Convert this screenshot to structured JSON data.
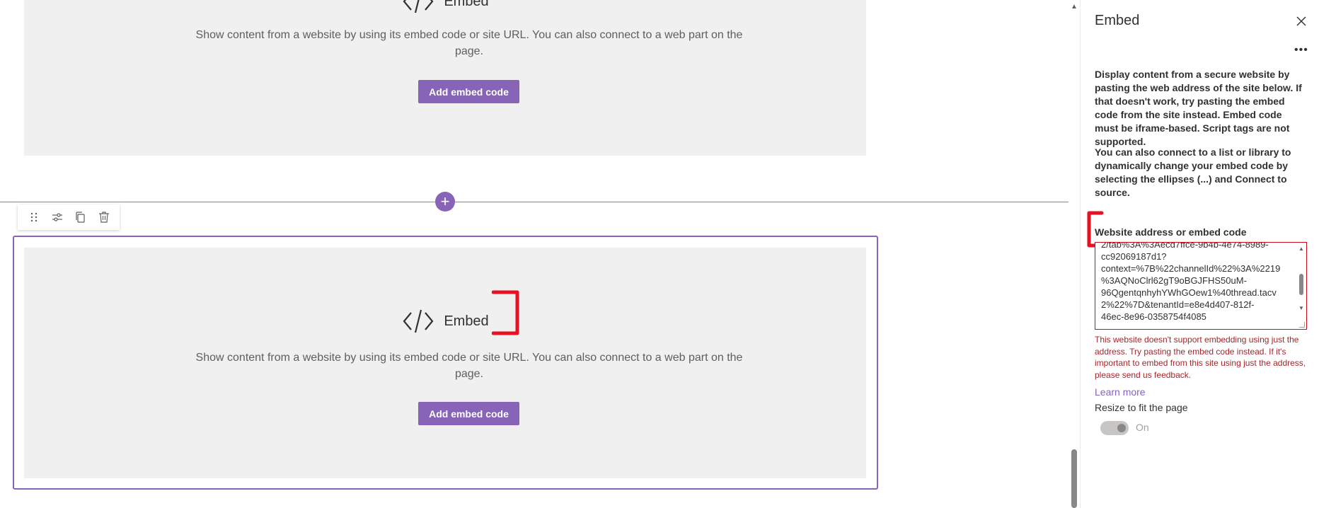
{
  "canvas": {
    "top_card": {
      "title": "Embed",
      "description": "Show content from a website by using its embed code or site URL. You can also connect to a web part on the page.",
      "button_label": "Add embed code"
    },
    "bottom_card": {
      "title": "Embed",
      "description": "Show content from a website by using its embed code or site URL. You can also connect to a web part on the page.",
      "button_label": "Add embed code"
    },
    "add_section_symbol": "+",
    "toolbar_icons": [
      "drag-handle-icon",
      "edit-properties-icon",
      "duplicate-icon",
      "delete-icon"
    ]
  },
  "pane": {
    "title": "Embed",
    "more_symbol": "•••",
    "paragraph_1": "Display content from a secure website by pasting the web address of the site below. If that doesn't work, try pasting the embed code from the site instead. Embed code must be iframe-based. Script tags are not supported.",
    "paragraph_2": "You can also connect to a list or library to dynamically change your embed code by selecting the ellipses (...) and Connect to source.",
    "field_label": "Website address or embed code",
    "field_value": "2/tab%3A%3Aecd7ffce-9b4b-4e74-8989-\ncc92069187d1?\ncontext=%7B%22channelId%22%3A%2219\n%3AQNoClrl62gT9oBGJFHS50uM-\n96QgentqnhyhYWhGOew1%40thread.tacv\n2%22%7D&tenantId=e8e4d407-812f-\n46ec-8e96-0358754f4085",
    "error_message": "This website doesn't support embedding using just the address. Try pasting the embed code instead. If it's important to embed from this site using just the address, please send us feedback.",
    "learn_more": "Learn more",
    "resize_label": "Resize to fit the page",
    "toggle_state": "On"
  },
  "colors": {
    "accent": "#8764b8",
    "error": "#a4262c",
    "annotation": "#e81123",
    "card_bg": "#f0f0f0"
  }
}
